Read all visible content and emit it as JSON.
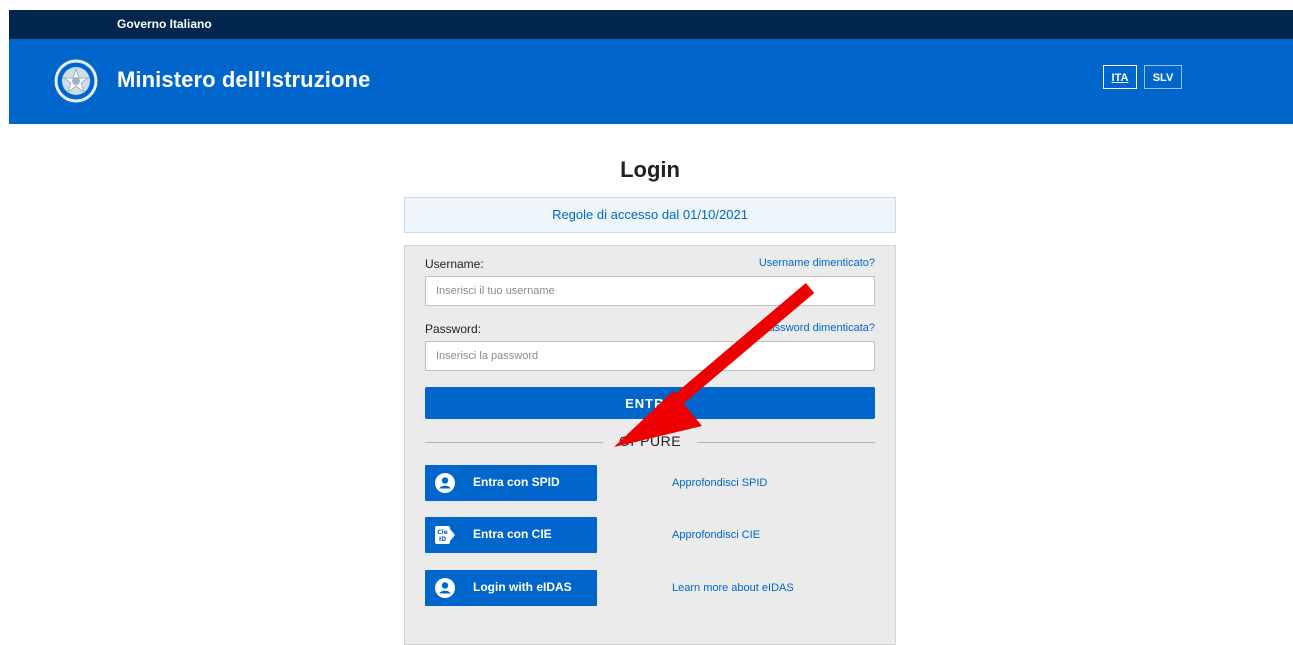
{
  "gov_bar": {
    "text": "Governo Italiano"
  },
  "header": {
    "title": "Ministero dell'Istruzione",
    "languages": [
      {
        "code": "ITA",
        "selected": true
      },
      {
        "code": "SLV",
        "selected": false
      }
    ]
  },
  "page": {
    "title": "Login",
    "notice": "Regole di accesso dal 01/10/2021"
  },
  "form": {
    "username_label": "Username:",
    "username_forgot": "Username dimenticato?",
    "username_placeholder": "Inserisci il tuo username",
    "username_value": "",
    "password_label": "Password:",
    "password_forgot": "Password dimenticata?",
    "password_placeholder": "Inserisci la password",
    "password_value": "",
    "enter_label": "ENTRA",
    "divider": "OPPURE"
  },
  "auth": [
    {
      "label": "Entra con SPID",
      "info": "Approfondisci SPID",
      "icon": "user-circle-icon"
    },
    {
      "label": "Entra con CIE",
      "info": "Approfondisci CIE",
      "icon": "cie-id-icon"
    },
    {
      "label": "Login with eIDAS",
      "info": "Learn more about eIDAS",
      "icon": "user-circle-icon"
    }
  ],
  "colors": {
    "gov_bar": "#00264d",
    "header": "#0066cc",
    "panel": "#ebebeb",
    "annotation_arrow": "#ee0000"
  }
}
